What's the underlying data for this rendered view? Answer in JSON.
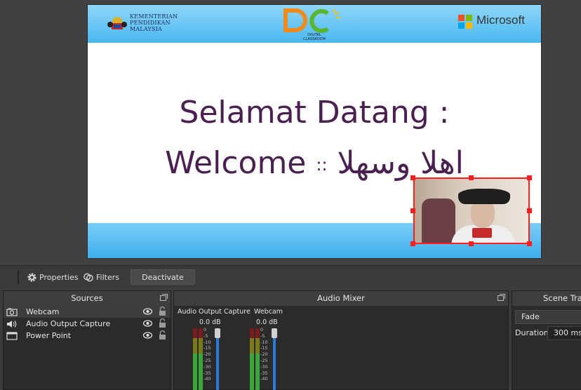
{
  "slide": {
    "ministry_lines": [
      "KEMENTERIAN",
      "PENDIDIKAN",
      "MALAYSIA"
    ],
    "dc_sub_lines": [
      "DIGITAL",
      "CLASSROOM"
    ],
    "ms_brand": "Microsoft",
    "title_line1": "Selamat Datang :",
    "title_line2_en": "Welcome",
    "title_line2_sep": "::",
    "title_line2_ar": "اهلا وسهلا"
  },
  "toolbar": {
    "properties_label": "Properties",
    "filters_label": "Filters",
    "deactivate_label": "Deactivate"
  },
  "sources": {
    "title": "Sources",
    "items": [
      {
        "label": "Webcam",
        "icon": "camera-icon"
      },
      {
        "label": "Audio Output Capture",
        "icon": "speaker-icon"
      },
      {
        "label": "Power Point",
        "icon": "window-icon"
      }
    ]
  },
  "mixer": {
    "title": "Audio Mixer",
    "channels": [
      {
        "name": "Audio Output Capture",
        "db": "0.0 dB"
      },
      {
        "name": "Webcam",
        "db": "0.0 dB"
      }
    ],
    "scale": [
      "0",
      "-5",
      "-10",
      "-15",
      "-20",
      "-25",
      "-30",
      "-35",
      "-40"
    ]
  },
  "transitions": {
    "title": "Scene Tran",
    "selected": "Fade",
    "duration_label": "Duration",
    "duration_value": "300 ms"
  },
  "colors": {
    "selection_handle": "#ff1e1e",
    "slide_text": "#4a2050",
    "slide_band": "#49b8f1",
    "fader": "#2a7bd6"
  }
}
